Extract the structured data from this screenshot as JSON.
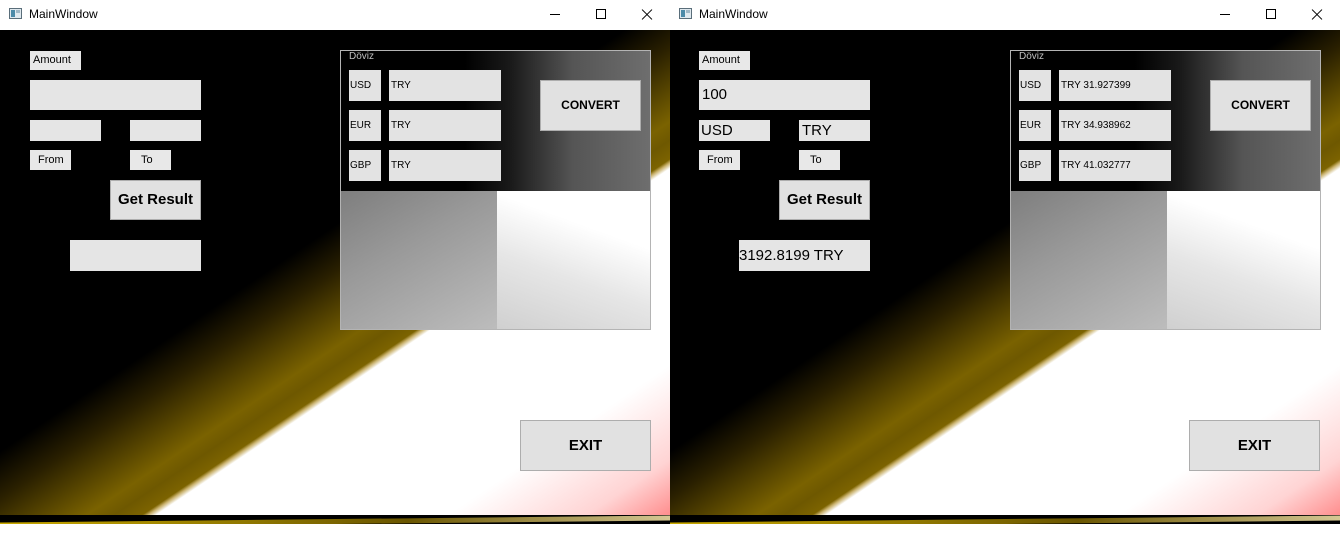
{
  "windows": [
    {
      "title": "MainWindow",
      "amount_label": "Amount",
      "amount_value": "",
      "from_value": "",
      "to_value": "",
      "from_label": "From",
      "to_label": "To",
      "get_result_label": "Get Result",
      "result_value": "",
      "group_title": "Döviz",
      "rates": [
        {
          "currency": "USD",
          "value": "TRY"
        },
        {
          "currency": "EUR",
          "value": "TRY"
        },
        {
          "currency": "GBP",
          "value": "TRY"
        }
      ],
      "convert_label": "CONVERT",
      "exit_label": "EXIT"
    },
    {
      "title": "MainWindow",
      "amount_label": "Amount",
      "amount_value": "100",
      "from_value": "USD",
      "to_value": "TRY",
      "from_label": "From",
      "to_label": "To",
      "get_result_label": "Get Result",
      "result_value": "3192.8199 TRY",
      "group_title": "Döviz",
      "rates": [
        {
          "currency": "USD",
          "value": "TRY 31.927399"
        },
        {
          "currency": "EUR",
          "value": "TRY 34.938962"
        },
        {
          "currency": "GBP",
          "value": "TRY 41.032777"
        }
      ],
      "convert_label": "CONVERT",
      "exit_label": "EXIT"
    }
  ]
}
